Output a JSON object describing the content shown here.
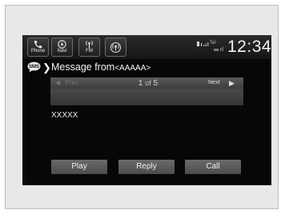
{
  "status_bar": {
    "buttons": [
      {
        "label": "Phone",
        "icon": "phone-icon"
      },
      {
        "label": "Navi",
        "icon": "navi-icon"
      },
      {
        "label": "FM",
        "icon": "fm-radio-icon"
      },
      {
        "label": "",
        "icon": "audio-icon"
      }
    ],
    "signal_text": "Tel",
    "clock": "12:34"
  },
  "title_bar": {
    "icon": "sms-icon",
    "title": "Message from",
    "sender": "<AAAAA>"
  },
  "pager": {
    "prev_label": "Prev",
    "current_page": "1",
    "of_text": "of",
    "total_pages": "5",
    "next_label": "Next"
  },
  "message": {
    "body": "XXXXX"
  },
  "actions": {
    "play_label": "Play",
    "reply_label": "Reply",
    "call_label": "Call"
  },
  "colors": {
    "screen_background": "#070707",
    "button_gray": "#5a5a5a",
    "bezel": "#e8e8e8",
    "text": "#f0f0f0"
  }
}
